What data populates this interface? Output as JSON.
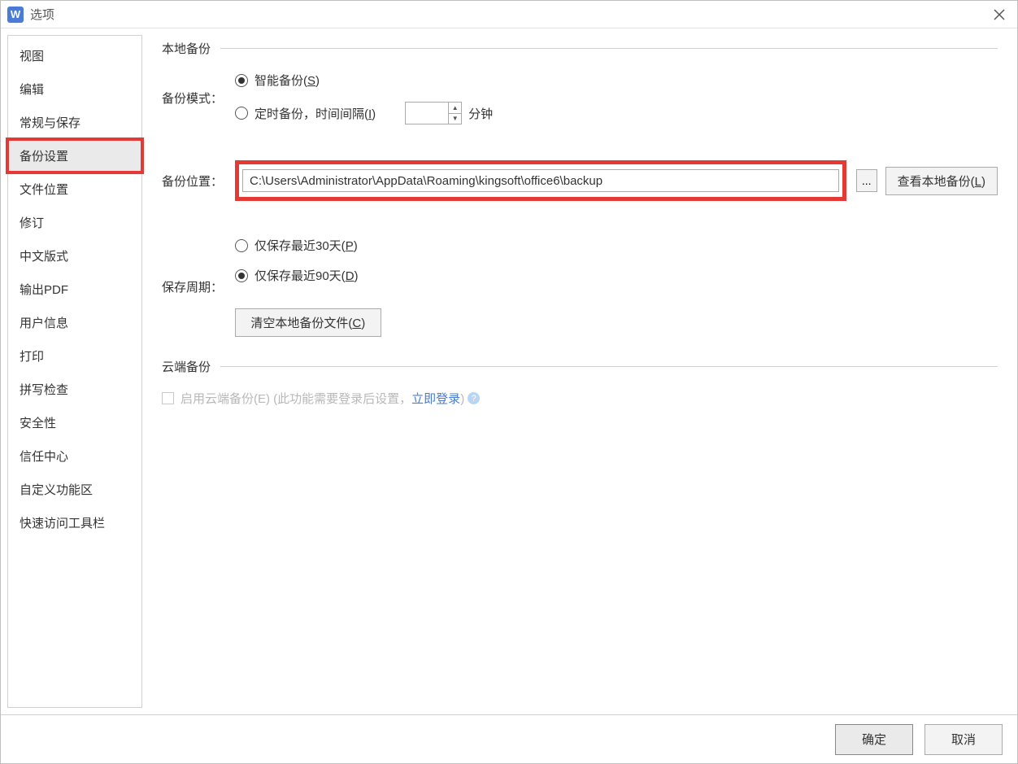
{
  "window": {
    "title": "选项"
  },
  "sidebar": {
    "items": [
      "视图",
      "编辑",
      "常规与保存",
      "备份设置",
      "文件位置",
      "修订",
      "中文版式",
      "输出PDF",
      "用户信息",
      "打印",
      "拼写检查",
      "安全性",
      "信任中心",
      "自定义功能区",
      "快速访问工具栏"
    ],
    "selected_index": 3
  },
  "local_backup": {
    "title": "本地备份",
    "mode_label": "备份模式：",
    "smart_option": "智能备份(S)",
    "timed_option_prefix": "定时备份，时间间隔(I)",
    "timed_option_suffix": "分钟",
    "interval_value": "",
    "location_label": "备份位置：",
    "path": "C:\\Users\\Administrator\\AppData\\Roaming\\kingsoft\\office6\\backup",
    "browse_btn": "...",
    "view_btn": "查看本地备份(L)",
    "retention_label": "保存周期：",
    "retention_30": "仅保存最近30天(P)",
    "retention_90": "仅保存最近90天(D)",
    "clear_btn": "清空本地备份文件(C)"
  },
  "cloud_backup": {
    "title": "云端备份",
    "enable_label": "启用云端备份(E)",
    "hint_prefix": "(此功能需要登录后设置，",
    "login_link": "立即登录",
    "hint_suffix": ")"
  },
  "footer": {
    "ok": "确定",
    "cancel": "取消"
  }
}
